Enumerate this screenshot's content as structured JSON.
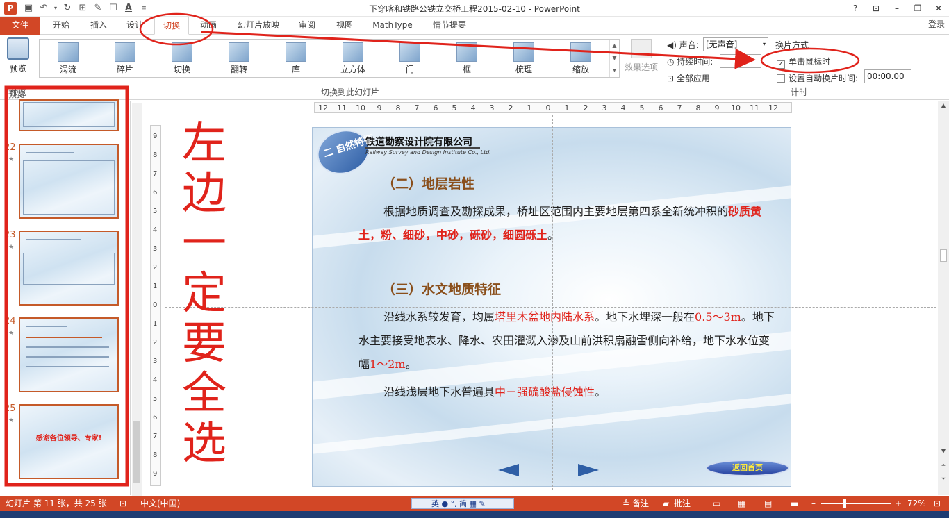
{
  "window": {
    "title": "下穿喀和铁路公铁立交桥工程2015-02-10 - PowerPoint",
    "buttons": [
      "?",
      "⊡",
      "–",
      "❐",
      "✕"
    ]
  },
  "quick_access": [
    "save-icon",
    "undo-icon",
    "redo-icon",
    "presentation-icon",
    "brush-icon",
    "textbox-icon",
    "font-color-icon",
    "customize-icon"
  ],
  "ribbon_tabs": [
    "文件",
    "开始",
    "插入",
    "设计",
    "切换",
    "动画",
    "幻灯片放映",
    "审阅",
    "视图",
    "MathType",
    "情节提要"
  ],
  "active_tab": "切换",
  "login": "登录",
  "preview": {
    "label": "预览",
    "group_label": "预览"
  },
  "transitions": {
    "items": [
      "涡流",
      "碎片",
      "切换",
      "翻转",
      "库",
      "立方体",
      "门",
      "框",
      "梳理",
      "缩放"
    ],
    "group_label": "切换到此幻灯片",
    "effect_options": "效果选项"
  },
  "timing": {
    "sound_label": "声音:",
    "sound_value": "[无声音]",
    "duration_label": "持续时间:",
    "apply_all": "全部应用",
    "advance_label": "换片方式",
    "on_click": "单击鼠标时",
    "on_click_checked": true,
    "auto_after": "设置自动换片时间:",
    "auto_time": "00:00.00",
    "group_label": "计时"
  },
  "thumbnails": {
    "pane_label": "预览",
    "slides": [
      {
        "num": ""
      },
      {
        "num": "22"
      },
      {
        "num": "23"
      },
      {
        "num": "24"
      },
      {
        "num": "25",
        "text": "感谢各位领导、专家!"
      }
    ]
  },
  "ruler": {
    "h_ticks": [
      "12",
      "11",
      "10",
      "9",
      "8",
      "7",
      "6",
      "5",
      "4",
      "3",
      "2",
      "1",
      "0",
      "1",
      "2",
      "3",
      "4",
      "5",
      "6",
      "7",
      "8",
      "9",
      "10",
      "11",
      "12"
    ],
    "v_ticks": [
      "9",
      "8",
      "7",
      "6",
      "5",
      "4",
      "3",
      "2",
      "1",
      "0",
      "1",
      "2",
      "3",
      "4",
      "5",
      "6",
      "7",
      "8",
      "9"
    ]
  },
  "slide": {
    "badge": "二 自然特征",
    "company_cn": "铁道勘察设计院有限公司",
    "company_en": "Railway Survey and Design Institute Co., Ltd.",
    "section1_title": "（二）地层岩性",
    "p1_a": "根据地质调查及勘探成果，桥址区范围内主要地层第四系全新统",
    "p1_b": "冲积的",
    "p1_red": "砂质黄土，粉、细砂，中砂，砾砂，细圆砾土",
    "p1_end": "。",
    "section2_title": "（三）水文地质特征",
    "p2_a": "沿线水系较发育，均属",
    "p2_red1": "塔里木盆地内陆水系",
    "p2_b": "。地下水埋深一般在",
    "p2_red2": "0.5～3m",
    "p2_c": "。地下水主要接受地表水、降水、农田灌溉入渗及山前洪积",
    "p2_d": "扇融雪侧向补给，地下水水位变幅",
    "p2_red3": "1～2m",
    "p2_e": "。",
    "p3_a": "沿线浅层地下水普遍具",
    "p3_red": "中－强硫酸盐侵蚀性",
    "p3_end": "。",
    "home_button": "返回首页"
  },
  "handwriting": "左边一定要全选",
  "statusbar": {
    "slide_info": "幻灯片 第 11 张，共 25 张",
    "language": "中文(中国)",
    "ime": "英 ● °, 简 ▦ ✎",
    "notes": "备注",
    "comments": "批注",
    "zoom": "72%",
    "zoom_minus": "–",
    "zoom_plus": "+"
  },
  "colors": {
    "accent": "#d24726",
    "annotation": "#e0231b"
  }
}
